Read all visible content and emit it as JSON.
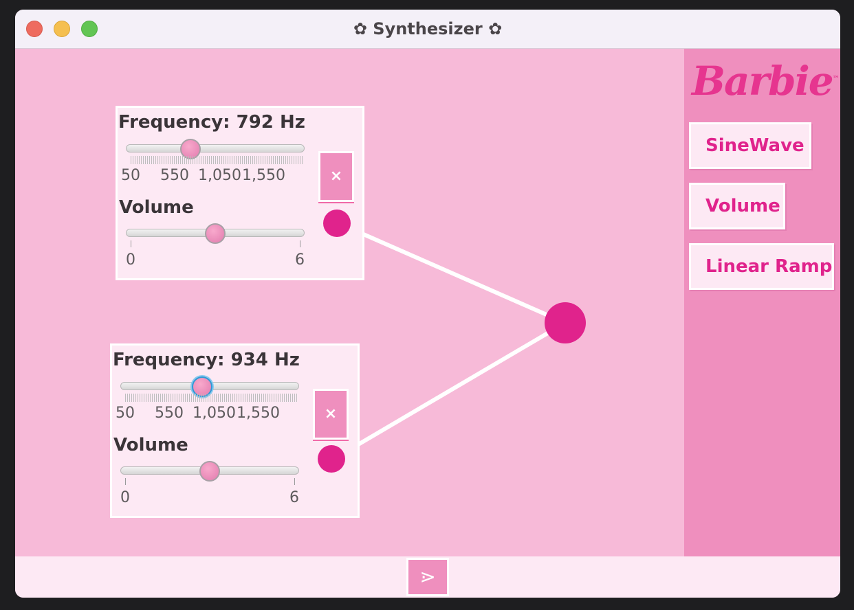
{
  "window": {
    "title": "✿ Synthesizer ✿"
  },
  "nodes": [
    {
      "frequency_label": "Frequency: 792 Hz",
      "frequency_ticks": [
        "50",
        "550",
        "1,050",
        "1,550"
      ],
      "frequency_value": 792,
      "volume_label": "Volume",
      "volume_min": "0",
      "volume_max": "6",
      "volume_value": 3,
      "close_label": "×"
    },
    {
      "frequency_label": "Frequency: 934 Hz",
      "frequency_ticks": [
        "50",
        "550",
        "1,050",
        "1,550"
      ],
      "frequency_value": 934,
      "volume_label": "Volume",
      "volume_min": "0",
      "volume_max": "6",
      "volume_value": 3,
      "close_label": "×"
    }
  ],
  "sidebar": {
    "logo": "Barbie",
    "logo_mark": "™",
    "buttons": [
      {
        "label": "SineWave"
      },
      {
        "label": "Volume"
      },
      {
        "label": "Linear Ramp"
      }
    ]
  },
  "footer": {
    "play_icon": "⋗"
  },
  "colors": {
    "canvas": "#f7bad8",
    "sidebar": "#ef8fbe",
    "accent": "#e0238c",
    "panel": "#fde9f4",
    "wire": "#ffffff"
  },
  "icons": {
    "close": "close-icon",
    "play": "play-icon",
    "port": "connector-port-icon"
  }
}
